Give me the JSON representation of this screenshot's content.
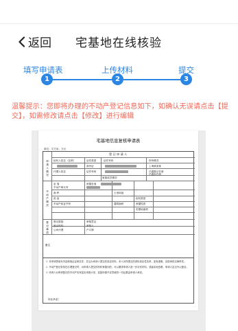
{
  "nav": {
    "back_label": "返回",
    "title": "宅基地在线核验"
  },
  "steps": [
    {
      "label": "填写申请表",
      "number": "1"
    },
    {
      "label": "上传材料",
      "number": "2"
    },
    {
      "label": "提交",
      "number": "3"
    }
  ],
  "warning": "温馨提示：您即将办理的不动产登记信息如下，如确认无误请点击【提交】，如需修改请点击【修改】进行编辑",
  "document": {
    "title": "宅基地信息复核申请表",
    "sub": "单位：平方米、万元",
    "row1": {
      "header": "登  记  申  请  人",
      "c1": "权利人姓名（名称）",
      "c2": "证件类型",
      "c3": "证件号码",
      "c4": "所有情况",
      "c5": "身份证",
      "c6": "代理人姓名",
      "c7": "证件号码",
      "c8": "上海某某某",
      "c9": "已婚登记在册",
      "c10": "已婚未在册",
      "c11": "家庭成员情况"
    },
    "section1": "申请人情况",
    "row2": {
      "c1": "坐  落",
      "c2": "不动产单元号",
      "c3": "面  积",
      "c4": "用  途",
      "c5": "房屋坐落",
      "c6": "土地用途",
      "c7": "权利类型",
      "c8": "房屋性质",
      "c9": "宅基地面积",
      "c10": "建筑面积",
      "c11": "不动产权证书号"
    },
    "section2": "不动产情况",
    "row3": {
      "c1": "登记原因",
      "c2": "登记机构",
      "c3": "审核意见",
      "c4": "审核人",
      "c5": "户口簿",
      "c6": "公司代理"
    },
    "section3": "登记事项",
    "section4": "备注",
    "notes": [
      "1. 本申请表填写内容和相应证明文件，并且为申请人提交的真实材料，本人对所提交的资料真实性负责，如有虚假，自愿承担法律责任。",
      "2. 不动产登记机构在办理登记时，对申请人提交的材料有疑问的，可以要求申请人进一步补充材料，或者实地查看，申请人应当予以配合。",
      "3. 申请人对申请登记的不动产负有如实申报义务，如因申报不实导致的一切后果由申请人承担。"
    ],
    "sign": "特此承诺！"
  },
  "colors": {
    "accent": "#2b86e3",
    "warning": "#ee6a58"
  }
}
